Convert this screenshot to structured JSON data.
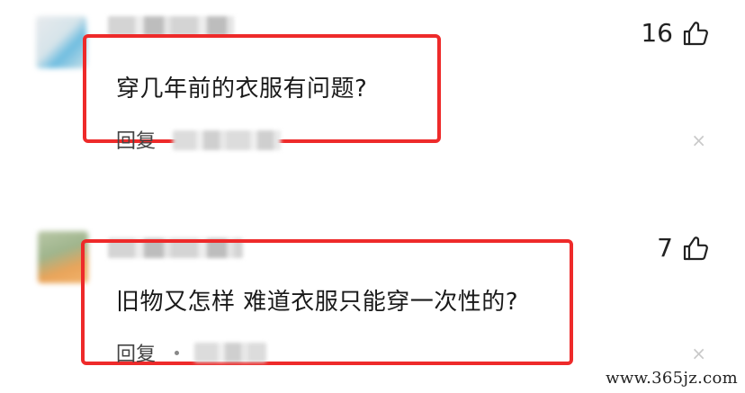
{
  "comments": [
    {
      "text": "穿几年前的衣服有问题?",
      "reply_label": "回复",
      "like_count": "16",
      "close_glyph": "×"
    },
    {
      "text": "旧物又怎样 难道衣服只能穿一次性的?",
      "reply_label": "回复",
      "like_count": "7",
      "close_glyph": "×"
    }
  ],
  "icons": {
    "like": "thumbs-up-icon",
    "close": "close-icon"
  },
  "colors": {
    "highlight": "#ee2a2a",
    "text": "#1a1a1a",
    "close": "#c9c9c9"
  },
  "watermark": "www.365jz.com"
}
